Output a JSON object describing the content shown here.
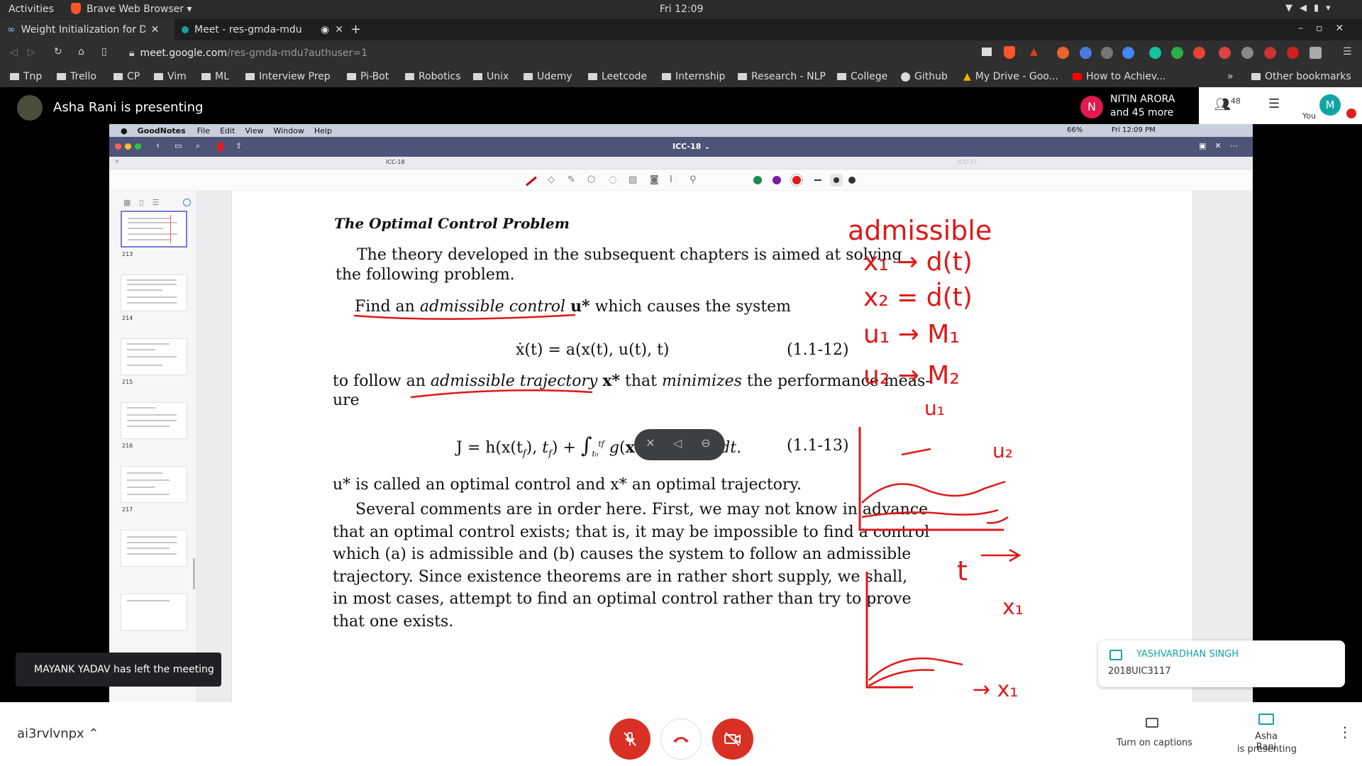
{
  "os_bar": {
    "activities": "Activities",
    "app_name": "Brave Web Browser",
    "clock": "Fri 12:09"
  },
  "tabs": [
    {
      "title": "Weight Initialization for De"
    },
    {
      "title": "Meet - res-gmda-mdu"
    }
  ],
  "url": {
    "host": "meet.google.com",
    "path": "/res-gmda-mdu?authuser=1"
  },
  "bookmarks": [
    "Tnp",
    "Trello",
    "CP",
    "Vim",
    "ML",
    "Interview Prep",
    "Pi-Bot",
    "Robotics",
    "Unix",
    "Udemy",
    "Leetcode",
    "Internship",
    "Research - NLP",
    "College",
    "Github",
    "My Drive - Goo...",
    "How to Achiev..."
  ],
  "bookmarks_overflow": "»",
  "other_bookmarks": "Other bookmarks",
  "meet": {
    "presenter_text": "Asha Rani is presenting",
    "participant_initial": "N",
    "participant_name": "NITIN ARORA",
    "participant_more": "and 45 more",
    "people_count": "48",
    "self_initial": "M",
    "self_label": "You"
  },
  "goodnotes": {
    "menu": [
      "GoodNotes",
      "File",
      "Edit",
      "View",
      "Window",
      "Help"
    ],
    "status": {
      "battery": "66%",
      "clock": "Fri 12:09 PM"
    },
    "doc_title": "ICC-18 ⌄",
    "left_tab": "ICC-18",
    "right_tab": "ICD-37",
    "pages": [
      "213",
      "214",
      "215",
      "216",
      "217"
    ],
    "ink_colors": [
      "#1c8a4c",
      "#7a1ca8",
      "#e01818"
    ]
  },
  "doc": {
    "heading": "The Optimal Control Problem",
    "p1a": "The theory developed in the subsequent chapters is aimed at solving",
    "p1b": "the following problem.",
    "p2_find": "Find an",
    "p2_ac": "admissible control",
    "p2_u": "u*",
    "p2_rest": "which causes the system",
    "eq1": "ẋ(t) = a(x(t), u(t), t)",
    "eq1_num": "(1.1-12)",
    "p3_to": "to follow an",
    "p3_at": "admissible trajectory",
    "p3_x": "x*",
    "p3_that": "that",
    "p3_min": "minimizes",
    "p3_rest": "the performance meas-",
    "p3_ure": "ure",
    "eq2": "J = h(x(t",
    "eq2_num": "(1.1-13)",
    "p4": "u* is called an optimal control and x* an optimal trajectory.",
    "p5": [
      "Several comments are in order here. First, we may not know in advance",
      "that an optimal control exists; that is, it may be impossible to find a control",
      "which (a) is admissible and (b) causes the system to follow an admissible",
      "trajectory. Since existence theorems are in rather short supply, we shall,",
      "in most cases, attempt to find an optimal control rather than try to prove",
      "that one exists."
    ]
  },
  "handwriting": [
    "admissible",
    "x₁ → d(t)",
    "x₂ = ḋ(t)",
    "u₁ → M₁",
    "u₂ → M₂",
    "u₁",
    "u₂",
    "t",
    "x₁",
    "→ x₁"
  ],
  "notifications": {
    "left": "MAYANK YADAV has left the meeting",
    "chat_name": "YASHVARDHAN SINGH",
    "chat_msg": "2018UIC3117"
  },
  "bottom": {
    "meeting_code": "ai3rvlvnpx",
    "captions": "Turn on captions",
    "presenting_line1": "Asha Rani",
    "presenting_line2": "is presenting"
  }
}
